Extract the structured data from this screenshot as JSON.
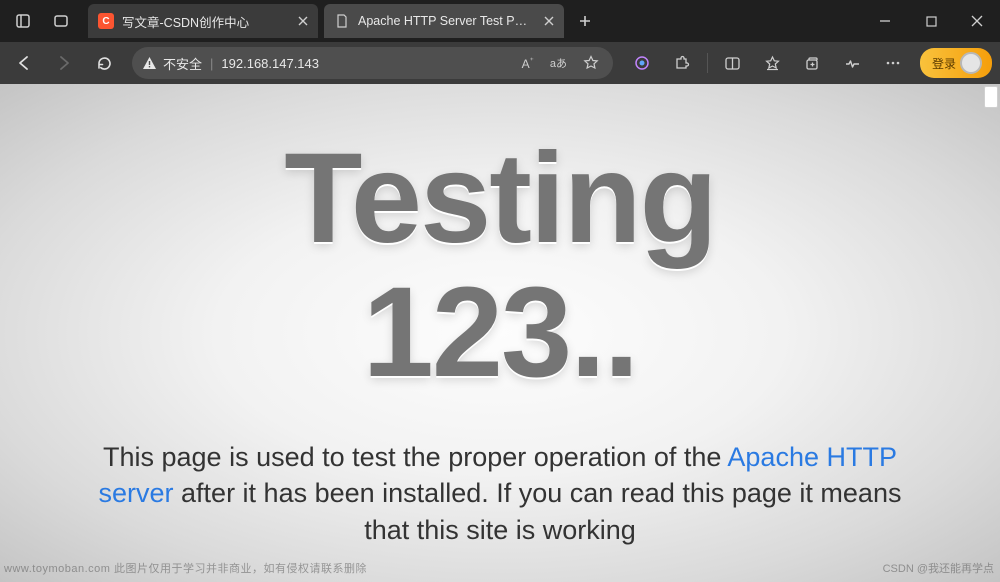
{
  "tabs": [
    {
      "label": "写文章-CSDN创作中心",
      "favicon": "csdn",
      "favicon_text": "C"
    },
    {
      "label": "Apache HTTP Server Test Page po",
      "favicon": "page"
    }
  ],
  "addressbar": {
    "security_text": "不安全",
    "url": "192.168.147.143",
    "reading_label": "A",
    "translate_label": "aあ"
  },
  "login_label": "登录",
  "page": {
    "heading_line1": "Testing",
    "heading_line2": "123..",
    "desc_pre": "This page is used to test the proper operation of the ",
    "desc_link": "Apache HTTP server",
    "desc_post": " after it has been installed. If you can read this page it means that this site is working"
  },
  "watermarks": {
    "left": "www.toymoban.com 此图片仅用于学习并非商业，如有侵权请联系删除",
    "right": "CSDN @我还能再学点"
  }
}
